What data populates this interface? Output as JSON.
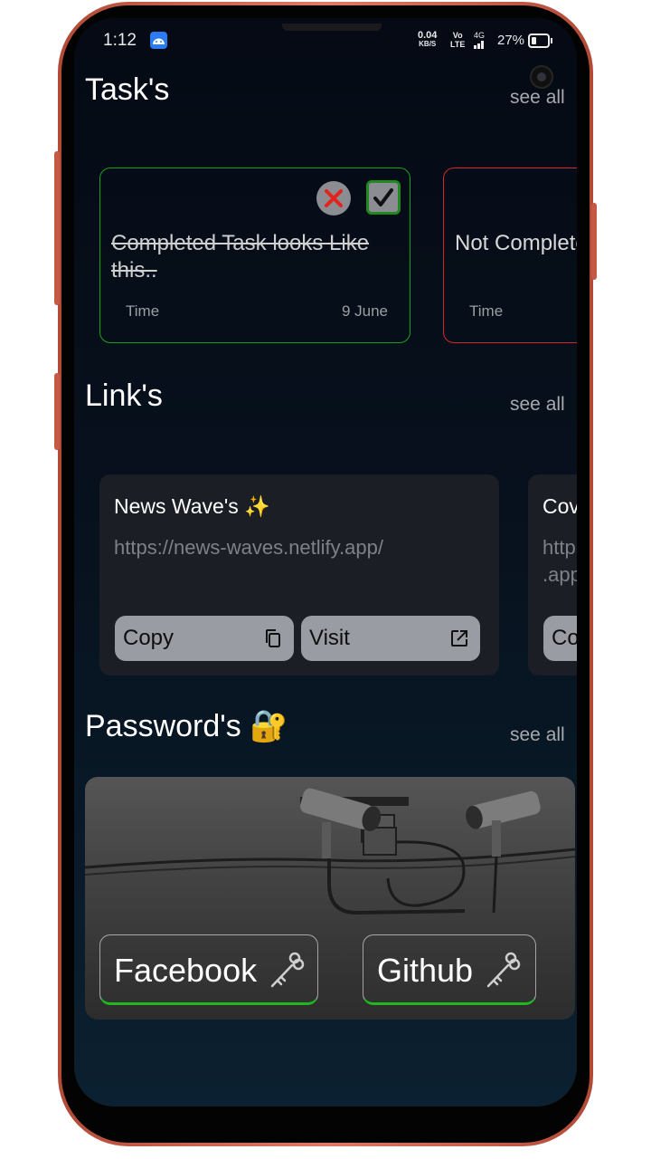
{
  "status_bar": {
    "time": "1:12",
    "net_speed": "0.04",
    "net_unit": "KB/S",
    "volte_top": "Vo",
    "volte_bottom": "LTE",
    "signal_type": "4G",
    "battery_percent": "27%"
  },
  "tasks": {
    "title": "Task's",
    "see_all": "see all",
    "cards": [
      {
        "text": "Completed Task looks Like this..",
        "time_label": "Time",
        "date": "9 June",
        "status": "completed",
        "border_color": "#1aa11a"
      },
      {
        "text": "Not Completed Task looks Like this..",
        "time_label": "Time",
        "date": "",
        "status": "not completed",
        "border_color": "#d12828"
      }
    ]
  },
  "links": {
    "title": "Link's",
    "see_all": "see all",
    "cards": [
      {
        "title": "News Wave's ✨",
        "url": "https://news-waves.netlify.app/",
        "copy_label": "Copy",
        "visit_label": "Visit"
      },
      {
        "title": "Cov",
        "url_line1": "http",
        "url_line2": ".app",
        "copy_label": "Cop"
      }
    ]
  },
  "passwords": {
    "title": "Password's 🔐",
    "see_all": "see all",
    "items": [
      {
        "label": "Facebook",
        "icon": "key-icon"
      },
      {
        "label": "Github",
        "icon": "key-icon"
      }
    ]
  },
  "colors": {
    "completed": "#1aa11a",
    "not_completed": "#d12828",
    "underline": "#1db91d",
    "button_gray": "#9a9ca3"
  }
}
